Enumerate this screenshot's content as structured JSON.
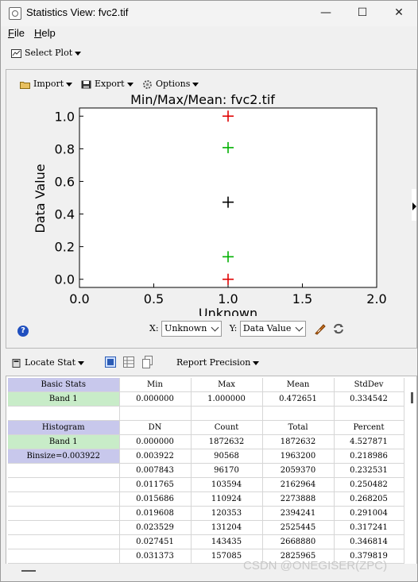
{
  "window": {
    "title": "Statistics View: fvc2.tif",
    "minimize": "—",
    "maximize": "☐",
    "close": "✕"
  },
  "menu": {
    "file_letter": "F",
    "file_rest": "ile",
    "help_letter": "H",
    "help_rest": "elp"
  },
  "top_toolbar": {
    "select_plot": "Select Plot"
  },
  "plot_toolbar": {
    "import": "Import",
    "export": "Export",
    "options": "Options"
  },
  "plot": {
    "title": "Min/Max/Mean: fvc2.tif",
    "xlabel": "Unknown",
    "ylabel": "Data Value"
  },
  "chart_data": {
    "type": "scatter",
    "title": "Min/Max/Mean: fvc2.tif",
    "xlabel": "Unknown",
    "ylabel": "Data Value",
    "xlim": [
      0.0,
      2.0
    ],
    "ylim": [
      -0.05,
      1.05
    ],
    "x_ticks": [
      "0.0",
      "0.5",
      "1.0",
      "1.5",
      "2.0"
    ],
    "y_ticks": [
      "0.0",
      "0.2",
      "0.4",
      "0.6",
      "0.8",
      "1.0"
    ],
    "grid": false,
    "marker": "plus",
    "points": [
      {
        "x": 1.0,
        "y": 1.0,
        "color": "#e00000"
      },
      {
        "x": 1.0,
        "y": 0.807,
        "color": "#00b000"
      },
      {
        "x": 1.0,
        "y": 0.472651,
        "color": "#000000"
      },
      {
        "x": 1.0,
        "y": 0.138,
        "color": "#00b000"
      },
      {
        "x": 1.0,
        "y": 0.0,
        "color": "#e00000"
      }
    ]
  },
  "axis_controls": {
    "x_label": "X:",
    "x_value": "Unknown",
    "y_label": "Y:",
    "y_value": "Data Value"
  },
  "stats_toolbar": {
    "locate_stat": "Locate Stat",
    "report_precision": "Report Precision"
  },
  "basic_stats": {
    "header": [
      "Basic Stats",
      "Min",
      "Max",
      "Mean",
      "StdDev"
    ],
    "row": [
      "Band 1",
      "0.000000",
      "1.000000",
      "0.472651",
      "0.334542"
    ]
  },
  "histogram": {
    "header": [
      "Histogram",
      "DN",
      "Count",
      "Total",
      "Percent"
    ],
    "labels": [
      "Band 1",
      "Binsize=0.003922"
    ],
    "rows": [
      [
        "0.000000",
        "1872632",
        "1872632",
        "4.527871"
      ],
      [
        "0.003922",
        "90568",
        "1963200",
        "0.218986"
      ],
      [
        "0.007843",
        "96170",
        "2059370",
        "0.232531"
      ],
      [
        "0.011765",
        "103594",
        "2162964",
        "0.250482"
      ],
      [
        "0.015686",
        "110924",
        "2273888",
        "0.268205"
      ],
      [
        "0.019608",
        "120353",
        "2394241",
        "0.291004"
      ],
      [
        "0.023529",
        "131204",
        "2525445",
        "0.317241"
      ],
      [
        "0.027451",
        "143435",
        "2668880",
        "0.346814"
      ],
      [
        "0.031373",
        "157085",
        "2825965",
        "0.379819"
      ]
    ]
  },
  "watermark": "CSDN @ONEGISER(ZPC)"
}
